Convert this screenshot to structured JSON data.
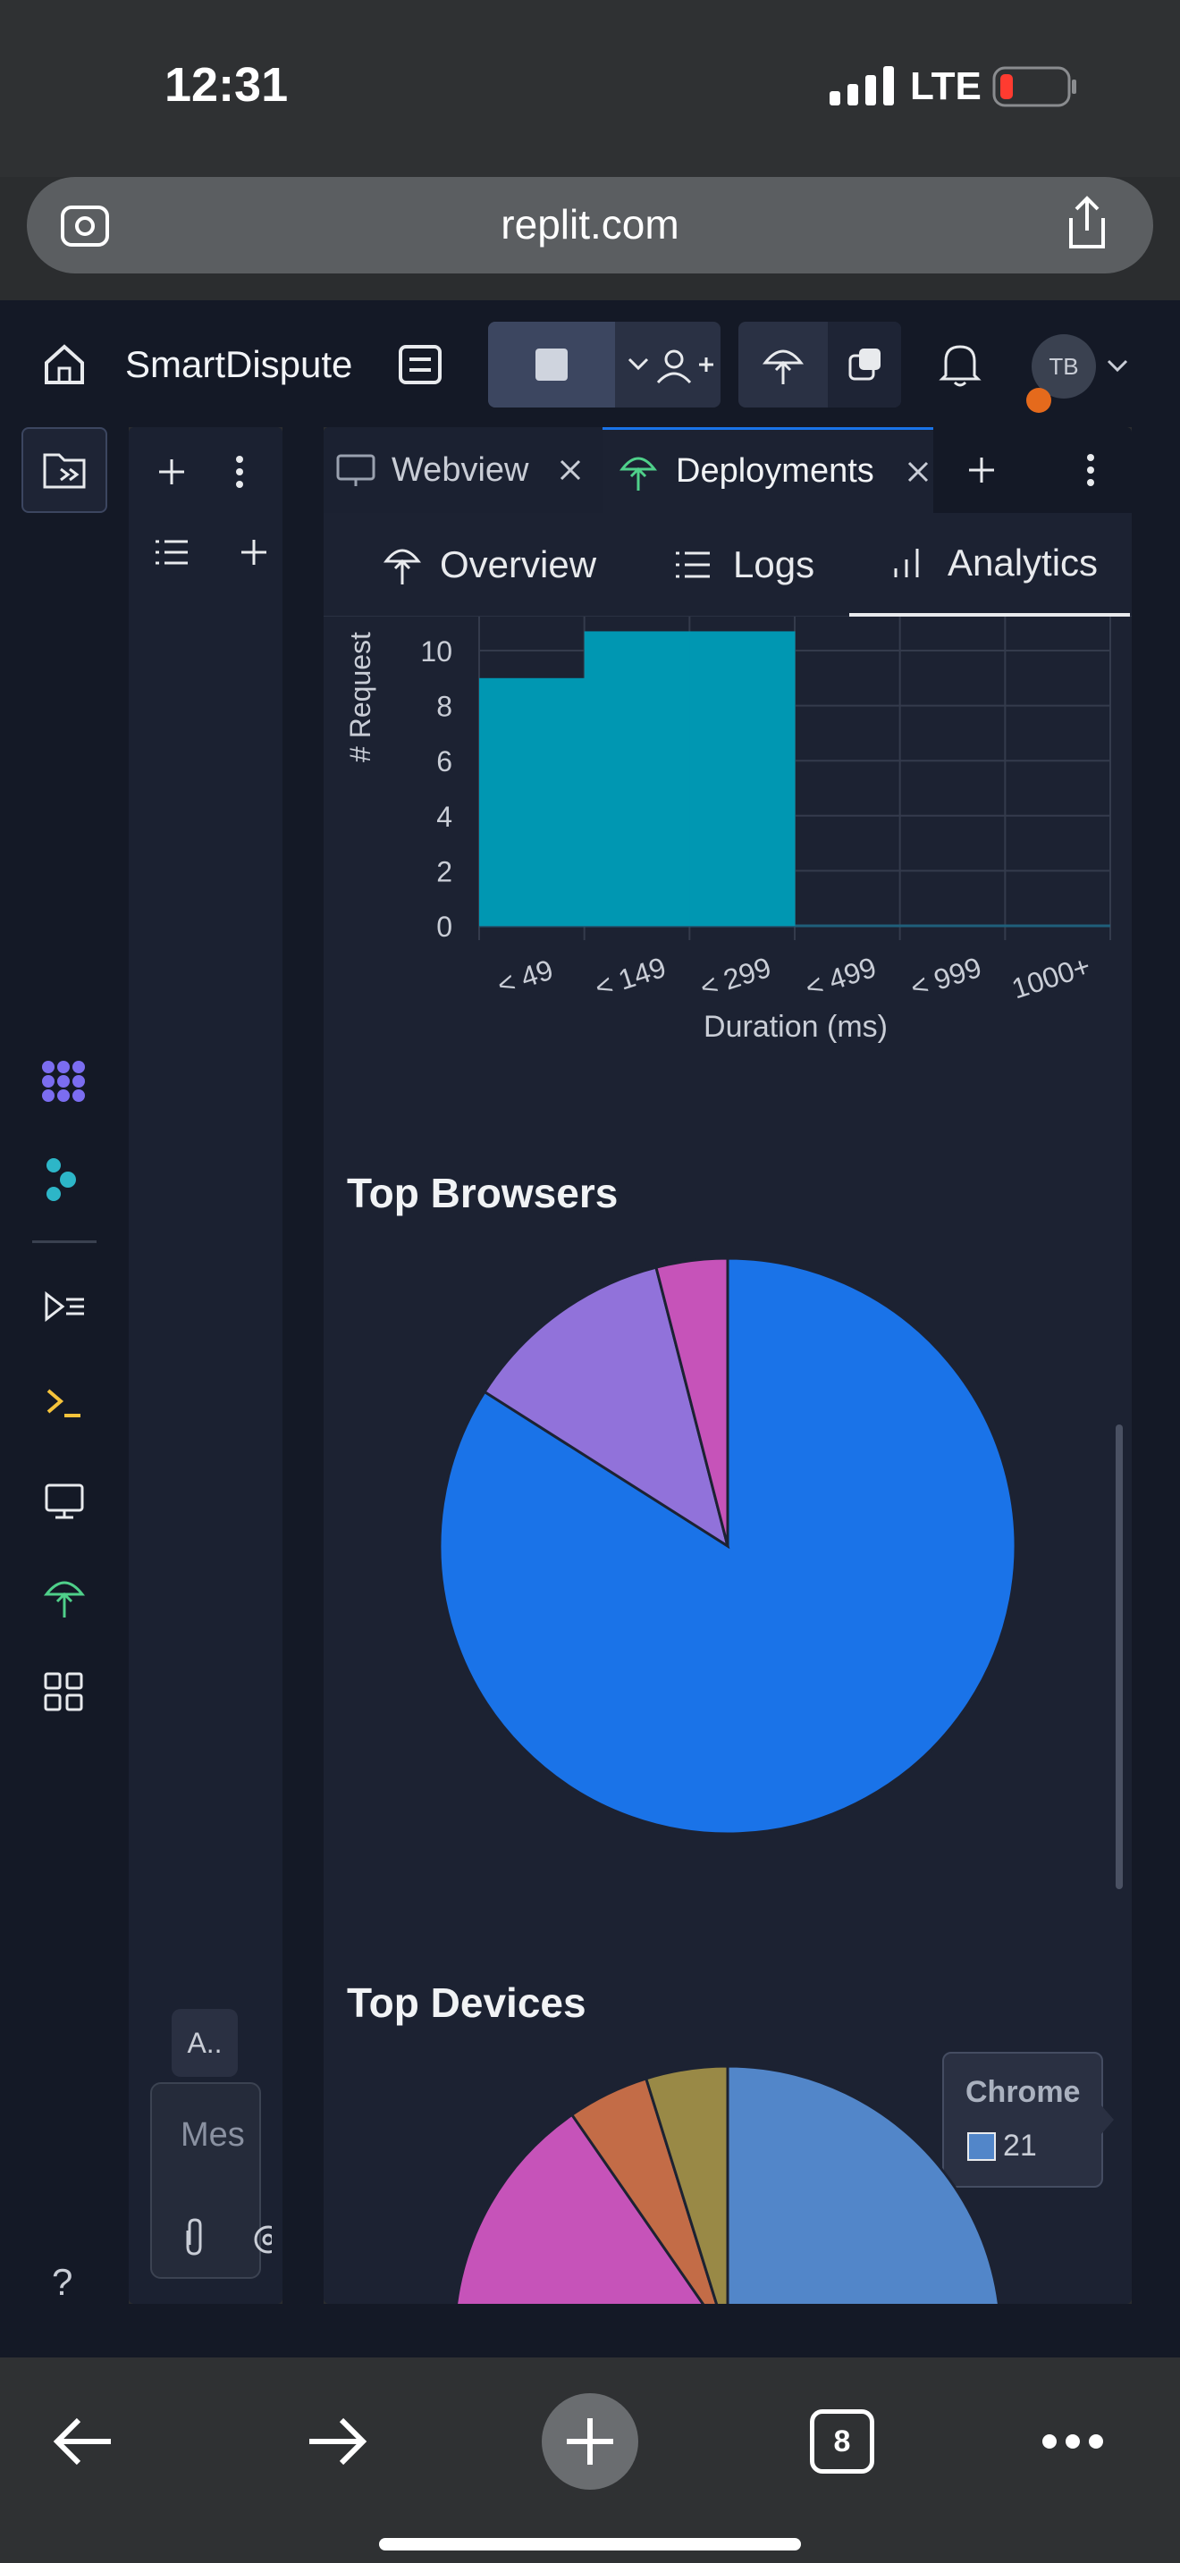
{
  "status_bar": {
    "time": "12:31",
    "network": "LTE"
  },
  "browser": {
    "url": "replit.com"
  },
  "app": {
    "project_name": "SmartDispute",
    "avatar_initials": "TB"
  },
  "tabs": [
    {
      "label": "Webview",
      "active": false
    },
    {
      "label": "Deployments",
      "active": true
    }
  ],
  "subtabs": [
    {
      "label": "Overview"
    },
    {
      "label": "Logs"
    },
    {
      "label": "Analytics",
      "active": true
    }
  ],
  "sidepanel": {
    "chip_label": "A..",
    "message_placeholder": "Mes"
  },
  "help_label": "?",
  "tab_count": "8",
  "colors": {
    "accent": "#0097b2",
    "chrome": "#1a73e8",
    "purple": "#9172da",
    "pink": "#c653b9"
  },
  "chart_data": [
    {
      "type": "bar",
      "ylabel": "# Request",
      "xlabel": "Duration (ms)",
      "categories": [
        "< 49",
        "< 149",
        "< 299",
        "< 499",
        "< 999",
        "1000+"
      ],
      "values": [
        9,
        11,
        11,
        0,
        0,
        0
      ],
      "ylim": [
        0,
        10
      ],
      "yticks": [
        0,
        2,
        4,
        6,
        8,
        10
      ],
      "grid": true
    },
    {
      "type": "pie",
      "title": "Top Browsers",
      "slices": [
        {
          "label": "Chrome",
          "value": 21,
          "color": "#1a73e8"
        },
        {
          "label": "",
          "value": 3,
          "color": "#9172da"
        },
        {
          "label": "",
          "value": 1,
          "color": "#c653b9"
        }
      ],
      "tooltip": {
        "label": "Chrome",
        "value": "21"
      }
    },
    {
      "type": "pie",
      "title": "Top Devices",
      "slices": [
        {
          "label": "",
          "value": 50,
          "color": "#5286c9"
        },
        {
          "label": "",
          "value": 25,
          "color": "#c653b9"
        },
        {
          "label": "",
          "value": 4,
          "color": "#c36c47"
        },
        {
          "label": "",
          "value": 4,
          "color": "#998946"
        }
      ]
    }
  ]
}
